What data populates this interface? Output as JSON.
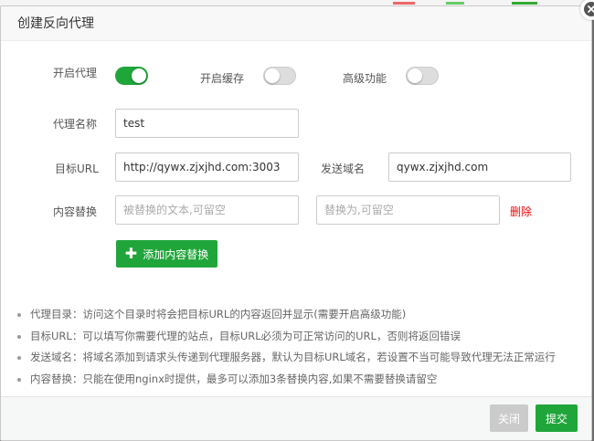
{
  "dialog": {
    "title": "创建反向代理"
  },
  "switches": {
    "proxy": {
      "label": "开启代理",
      "on": true
    },
    "cache": {
      "label": "开启缓存",
      "on": false
    },
    "advanced": {
      "label": "高级功能",
      "on": false
    }
  },
  "form": {
    "proxy_name": {
      "label": "代理名称",
      "value": "test"
    },
    "target_url": {
      "label": "目标URL",
      "value": "http://qywx.zjxjhd.com:3003"
    },
    "send_domain": {
      "label": "发送域名",
      "value": "qywx.zjxjhd.com"
    },
    "content_replace": {
      "label": "内容替换",
      "from_placeholder": "被替换的文本,可留空",
      "to_placeholder": "替换为,可留空",
      "delete_label": "删除"
    },
    "add_button": {
      "icon": "plus-icon",
      "label": "添加内容替换"
    }
  },
  "notes": [
    "代理目录：访问这个目录时将会把目标URL的内容返回并显示(需要开启高级功能)",
    "目标URL：可以填写你需要代理的站点，目标URL必须为可正常访问的URL，否则将返回错误",
    "发送域名：将域名添加到请求头传递到代理服务器，默认为目标URL域名，若设置不当可能导致代理无法正常运行",
    "内容替换：只能在使用nginx时提供，最多可以添加3条替换内容,如果不需要替换请留空"
  ],
  "footer": {
    "close_label": "关闭",
    "submit_label": "提交"
  },
  "colors": {
    "accent": "#20a53a",
    "danger": "#ef0808",
    "disabled": "#cbcbcb"
  }
}
